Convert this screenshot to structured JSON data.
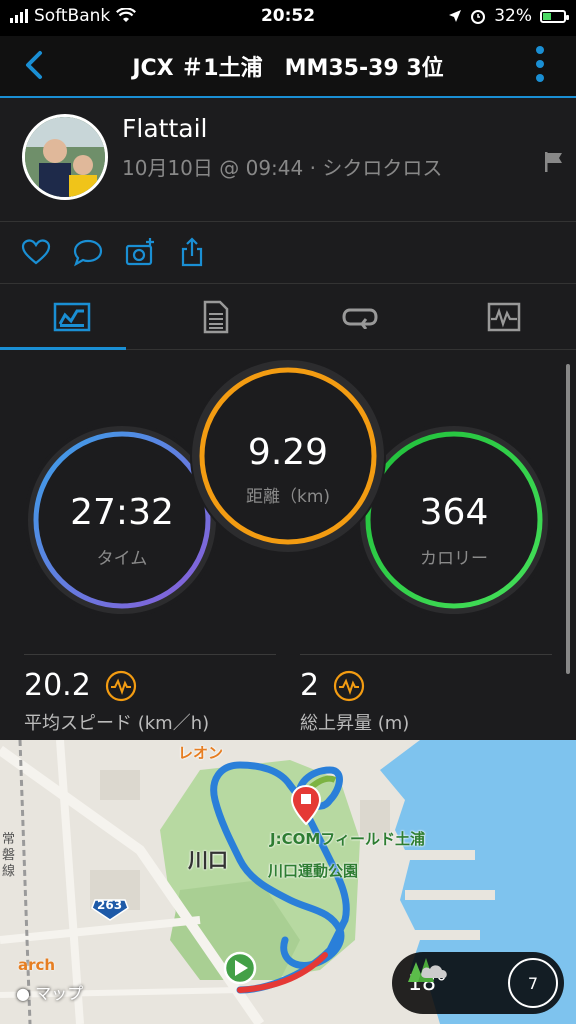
{
  "status_bar": {
    "carrier": "SoftBank",
    "time": "20:52",
    "battery": "32%"
  },
  "header": {
    "title": "JCX ＃1土浦　MM35-39 3位"
  },
  "profile": {
    "name": "Flattail",
    "meta": "10月10日 @ 09:44 · シクロクロス"
  },
  "tabs": [
    {
      "icon": "overview-icon",
      "active": true
    },
    {
      "icon": "details-icon",
      "active": false
    },
    {
      "icon": "laps-icon",
      "active": false
    },
    {
      "icon": "charts-icon",
      "active": false
    }
  ],
  "stats": {
    "time": {
      "value": "27:32",
      "label": "タイム"
    },
    "distance": {
      "value": "9.29",
      "label": "距離（km)"
    },
    "calories": {
      "value": "364",
      "label": "カロリー"
    },
    "avg_speed": {
      "value": "20.2",
      "label": "平均スピード (km／h)"
    },
    "elevation_gain": {
      "value": "2",
      "label": "総上昇量 (m)"
    }
  },
  "map": {
    "labels": {
      "leon": "レオン",
      "kawaguchi": "川口",
      "jcom": "J:COMフィールド土浦",
      "park": "川口運動公園",
      "road_263": "263",
      "joban": "常磐線",
      "arch": "arch",
      "apple_maps": "マップ"
    },
    "weather": {
      "temp": "18°",
      "wind": "7"
    }
  },
  "colors": {
    "accent": "#1a8fd4",
    "time_ring": "#4a6fd9",
    "distance_ring": "#f39c12",
    "calorie_ring": "#2ecc40"
  }
}
